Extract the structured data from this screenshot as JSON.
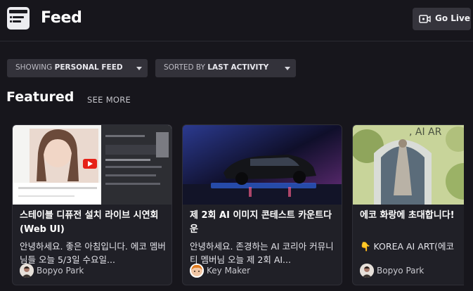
{
  "header": {
    "app_icon": "feed-window-icon",
    "title": "Feed",
    "go_live": {
      "icon": "video-camera-icon",
      "label": "Go Live"
    }
  },
  "filters": [
    {
      "prefix": "SHOWING ",
      "value": "PERSONAL FEED",
      "icon": "caret-down-icon"
    },
    {
      "prefix": "SORTED BY ",
      "value": "LAST ACTIVITY",
      "icon": "caret-down-icon"
    }
  ],
  "featured": {
    "title": "Featured",
    "see_more": "SEE MORE",
    "cards": [
      {
        "title": "스테이블 디퓨전 설치 라이브 시연회(Web UI)",
        "excerpt": "안녕하세요. 좋은 아침입니다. 에코 멤버님들 오늘 5/3일 수요일...",
        "author": "Bopyo Park"
      },
      {
        "title": "제 2회 AI 이미지 콘테스트 카운트다운",
        "excerpt": "안녕하세요. 존경하는 AI 코리아 커뮤니티 멤버님 오늘 제 2회 AI...",
        "author": "Key Maker"
      },
      {
        "title": "에코 화랑에 초대합니다!",
        "excerpt": "👇 KOREA AI ART(에코",
        "author": "Bopyo Park"
      }
    ]
  },
  "colors": {
    "background": "#17161c",
    "card": "#202027",
    "button": "#35343c",
    "youtube_red": "#e62117"
  }
}
